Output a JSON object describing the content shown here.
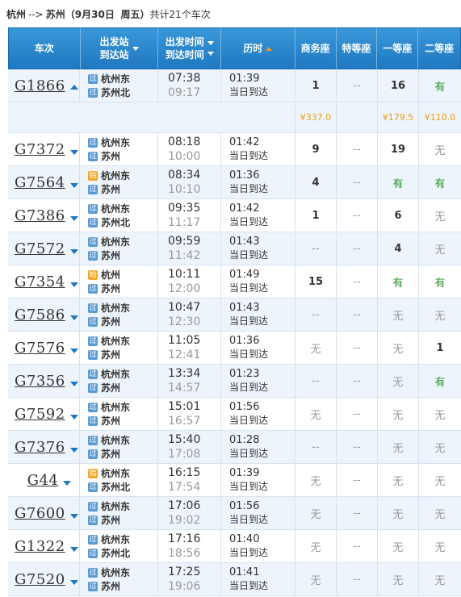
{
  "route": {
    "from": "杭州",
    "arrow": "-->",
    "to": "苏州",
    "date_label": "9月30日",
    "weekday": "周五",
    "summary": "共计21个车次"
  },
  "headers": {
    "train": "车次",
    "station_top": "出发站",
    "station_bottom": "到达站",
    "time_top": "出发时间",
    "time_bottom": "到达时间",
    "duration": "历时",
    "business": "商务座",
    "special": "特等座",
    "first": "一等座",
    "second": "二等座"
  },
  "price_row": {
    "business": "¥337.0",
    "special": "",
    "first": "¥179.5",
    "second": "¥110.0"
  },
  "trains": [
    {
      "no": "G1866",
      "from_badge": "过",
      "from": "杭州东",
      "to_badge": "过",
      "to": "苏州北",
      "dep": "07:38",
      "arr": "09:17",
      "dur": "01:39",
      "arrive": "当日到达",
      "business": "1",
      "special": "--",
      "first": "16",
      "second": "有"
    },
    {
      "no": "G7372",
      "from_badge": "过",
      "from": "杭州东",
      "to_badge": "过",
      "to": "苏州",
      "dep": "08:18",
      "arr": "10:00",
      "dur": "01:42",
      "arrive": "当日到达",
      "business": "9",
      "special": "--",
      "first": "19",
      "second": "无"
    },
    {
      "no": "G7564",
      "from_badge": "始",
      "from": "杭州东",
      "to_badge": "过",
      "to": "苏州",
      "dep": "08:34",
      "arr": "10:10",
      "dur": "01:36",
      "arrive": "当日到达",
      "business": "4",
      "special": "--",
      "first": "有",
      "second": "有"
    },
    {
      "no": "G7386",
      "from_badge": "过",
      "from": "杭州东",
      "to_badge": "过",
      "to": "苏州北",
      "dep": "09:35",
      "arr": "11:17",
      "dur": "01:42",
      "arrive": "当日到达",
      "business": "1",
      "special": "--",
      "first": "6",
      "second": "无"
    },
    {
      "no": "G7572",
      "from_badge": "过",
      "from": "杭州东",
      "to_badge": "过",
      "to": "苏州",
      "dep": "09:59",
      "arr": "11:42",
      "dur": "01:43",
      "arrive": "当日到达",
      "business": "--",
      "special": "--",
      "first": "4",
      "second": "无"
    },
    {
      "no": "G7354",
      "from_badge": "始",
      "from": "杭州",
      "to_badge": "过",
      "to": "苏州",
      "dep": "10:11",
      "arr": "12:00",
      "dur": "01:49",
      "arrive": "当日到达",
      "business": "15",
      "special": "--",
      "first": "有",
      "second": "有"
    },
    {
      "no": "G7586",
      "from_badge": "过",
      "from": "杭州东",
      "to_badge": "过",
      "to": "苏州",
      "dep": "10:47",
      "arr": "12:30",
      "dur": "01:43",
      "arrive": "当日到达",
      "business": "--",
      "special": "--",
      "first": "无",
      "second": "无"
    },
    {
      "no": "G7576",
      "from_badge": "过",
      "from": "杭州东",
      "to_badge": "过",
      "to": "苏州",
      "dep": "11:05",
      "arr": "12:41",
      "dur": "01:36",
      "arrive": "当日到达",
      "business": "无",
      "special": "--",
      "first": "无",
      "second": "1"
    },
    {
      "no": "G7356",
      "from_badge": "过",
      "from": "杭州东",
      "to_badge": "过",
      "to": "苏州",
      "dep": "13:34",
      "arr": "14:57",
      "dur": "01:23",
      "arrive": "当日到达",
      "business": "--",
      "special": "--",
      "first": "无",
      "second": "有"
    },
    {
      "no": "G7592",
      "from_badge": "过",
      "from": "杭州东",
      "to_badge": "过",
      "to": "苏州",
      "dep": "15:01",
      "arr": "16:57",
      "dur": "01:56",
      "arrive": "当日到达",
      "business": "无",
      "special": "--",
      "first": "无",
      "second": "无"
    },
    {
      "no": "G7376",
      "from_badge": "过",
      "from": "杭州东",
      "to_badge": "过",
      "to": "苏州",
      "dep": "15:40",
      "arr": "17:08",
      "dur": "01:28",
      "arrive": "当日到达",
      "business": "--",
      "special": "--",
      "first": "无",
      "second": "无"
    },
    {
      "no": "G44",
      "from_badge": "始",
      "from": "杭州东",
      "to_badge": "过",
      "to": "苏州北",
      "dep": "16:15",
      "arr": "17:54",
      "dur": "01:39",
      "arrive": "当日到达",
      "business": "无",
      "special": "--",
      "first": "无",
      "second": "无"
    },
    {
      "no": "G7600",
      "from_badge": "过",
      "from": "杭州东",
      "to_badge": "过",
      "to": "苏州",
      "dep": "17:06",
      "arr": "19:02",
      "dur": "01:56",
      "arrive": "当日到达",
      "business": "无",
      "special": "--",
      "first": "无",
      "second": "无"
    },
    {
      "no": "G1322",
      "from_badge": "过",
      "from": "杭州东",
      "to_badge": "过",
      "to": "苏州北",
      "dep": "17:16",
      "arr": "18:56",
      "dur": "01:40",
      "arrive": "当日到达",
      "business": "无",
      "special": "--",
      "first": "无",
      "second": "无"
    },
    {
      "no": "G7520",
      "from_badge": "过",
      "from": "杭州东",
      "to_badge": "过",
      "to": "苏州",
      "dep": "17:25",
      "arr": "19:06",
      "dur": "01:41",
      "arrive": "当日到达",
      "business": "无",
      "special": "--",
      "first": "无",
      "second": "无"
    }
  ],
  "colors": {
    "header_blue": "#1f78c1",
    "row_alt": "#edf4fb",
    "available_green": "#2a8f2a",
    "price_orange": "#f39c12",
    "sort_active_orange": "#f39c12"
  }
}
